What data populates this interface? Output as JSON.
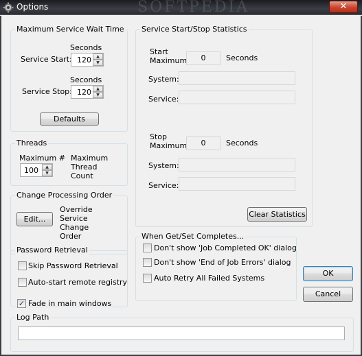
{
  "window": {
    "title": "Options",
    "watermark": "SOFTPEDIA",
    "close_glyph": "✕",
    "icon": "gear-icon"
  },
  "wait_time": {
    "legend": "Maximum Service Wait Time",
    "seconds_label_1": "Seconds",
    "service_start_label": "Service Start:",
    "service_start_value": "120",
    "seconds_label_2": "Seconds",
    "service_stop_label": "Service Stop:",
    "service_stop_value": "120",
    "defaults_label": "Defaults"
  },
  "threads": {
    "legend": "Threads",
    "max_label": "Maximum #",
    "max_value": "100",
    "desc": "Maximum Thread Count"
  },
  "change_order": {
    "legend": "Change Processing Order",
    "edit_label": "Edit...",
    "desc": "Override Service Change Order"
  },
  "password": {
    "legend": "Password Retrieval",
    "skip_label": "Skip Password Retrieval",
    "skip_checked": false,
    "autostart_label": "Auto-start remote registry",
    "autostart_checked": false
  },
  "fade": {
    "label": "Fade in main windows",
    "checked": true,
    "check_glyph": "✓"
  },
  "log": {
    "legend": "Log Path",
    "value": ""
  },
  "stats": {
    "legend": "Service Start/Stop Statistics",
    "start_label": "Start Maximum:",
    "start_value": "0",
    "start_unit": "Seconds",
    "system_label_1": "System:",
    "system_value_1": "",
    "service_label_1": "Service:",
    "service_value_1": "",
    "stop_label": "Stop Maximum:",
    "stop_value": "0",
    "stop_unit": "Seconds",
    "system_label_2": "System:",
    "system_value_2": "",
    "service_label_2": "Service:",
    "service_value_2": "",
    "clear_label": "Clear Statistics"
  },
  "when": {
    "legend": "When Get/Set Completes...",
    "opt1_label": "Don't show 'Job Completed OK' dialog",
    "opt1_checked": false,
    "opt2_label": "Don't show 'End of Job Errors' dialog",
    "opt2_checked": false,
    "opt3_label": "Auto Retry All Failed Systems",
    "opt3_checked": false
  },
  "buttons": {
    "ok": "OK",
    "cancel": "Cancel"
  }
}
